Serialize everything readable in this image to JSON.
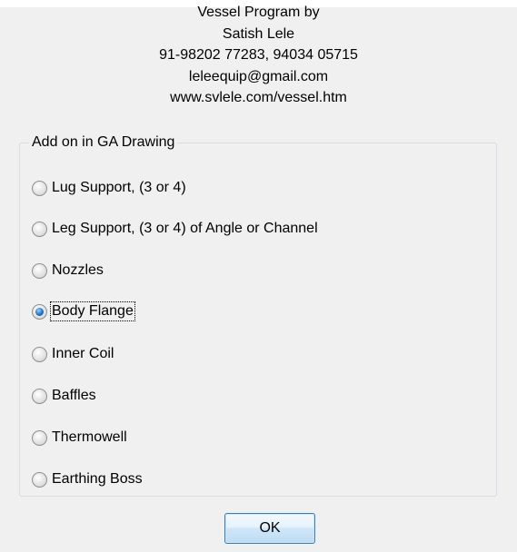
{
  "header": {
    "lines": [
      "Vessel Program by",
      "Satish Lele",
      "91-98202 77283, 94034 05715",
      "leleequip@gmail.com",
      "www.svlele.com/vessel.htm"
    ]
  },
  "group": {
    "title": "Add on in GA Drawing",
    "options": [
      {
        "label": "Lug Support, (3 or 4)",
        "checked": false
      },
      {
        "label": "Leg Support, (3 or 4) of Angle or Channel",
        "checked": false
      },
      {
        "label": "Nozzles",
        "checked": false
      },
      {
        "label": "Body Flange",
        "checked": true
      },
      {
        "label": "Inner Coil",
        "checked": false
      },
      {
        "label": "Baffles",
        "checked": false
      },
      {
        "label": "Thermowell",
        "checked": false
      },
      {
        "label": "Earthing Boss",
        "checked": false
      }
    ]
  },
  "ok_button": {
    "label": "OK"
  }
}
